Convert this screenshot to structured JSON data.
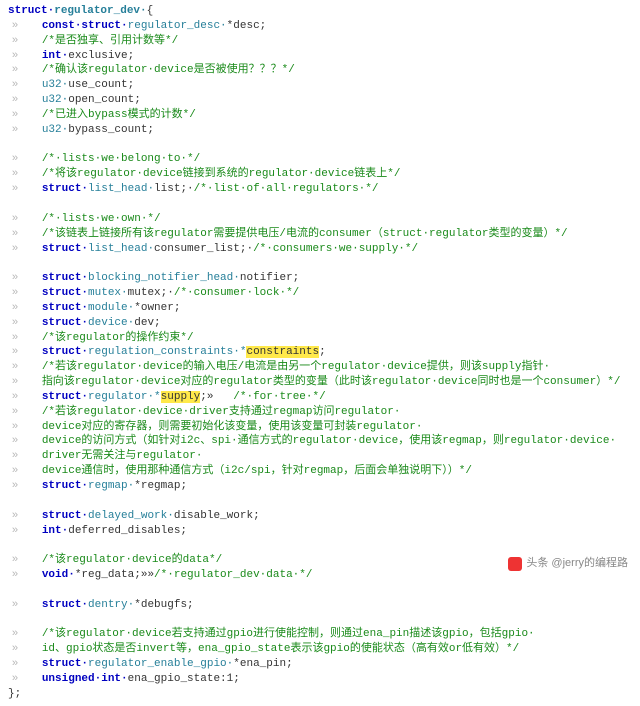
{
  "struct_name": "regulator_dev",
  "hl_constraints": "constraints",
  "hl_supply": "supply",
  "watermark": "头条 @jerry的编程路",
  "lines": {
    "l00a": "struct·",
    "l00b": "regulator_dev·",
    "l00c": "{",
    "l01a": "const·struct·",
    "l01b": "regulator_desc·",
    "l01c": "*desc;",
    "l02": "/*是否独享、引用计数等*/",
    "l03a": "int·",
    "l03b": "exclusive;",
    "l04": "/*确认该regulator·device是否被使用？？？*/",
    "l05a": "u32·",
    "l05b": "use_count;",
    "l06a": "u32·",
    "l06b": "open_count;",
    "l07": "/*已进入bypass模式的计数*/",
    "l08a": "u32·",
    "l08b": "bypass_count;",
    "l09": "/*·lists·we·belong·to·*/",
    "l10": "/*将该regulator·device链接到系统的regulator·device链表上*/",
    "l11a": "struct·",
    "l11b": "list_head·",
    "l11c": "list;·",
    "l11d": "/*·list·of·all·regulators·*/",
    "l12": "/*·lists·we·own·*/",
    "l13": "/*该链表上链接所有该regulator需要提供电压/电流的consumer（struct·regulator类型的变量）*/",
    "l14a": "struct·",
    "l14b": "list_head·",
    "l14c": "consumer_list;·",
    "l14d": "/*·consumers·we·supply·*/",
    "l15a": "struct·",
    "l15b": "blocking_notifier_head·",
    "l15c": "notifier;",
    "l16a": "struct·",
    "l16b": "mutex·",
    "l16c": "mutex;·",
    "l16d": "/*·consumer·lock·*/",
    "l17a": "struct·",
    "l17b": "module·",
    "l17c": "*owner;",
    "l18a": "struct·",
    "l18b": "device·",
    "l18c": "dev;",
    "l19": "/*该regulator的操作约束*/",
    "l20a": "struct·",
    "l20b": "regulation_constraints·*",
    "l20d": ";",
    "l21": "/*若该regulator·device的输入电压/电流是由另一个regulator·device提供，则该supply指针·",
    "l22": "指向该regulator·device对应的regulator类型的变量（此时该regulator·device同时也是一个consumer）*/",
    "l23a": "struct·",
    "l23b": "regulator·*",
    "l23d": ";»   ",
    "l23e": "/*·for·tree·*/",
    "l24": "/*若该regulator·device·driver支持通过regmap访问regulator·",
    "l25": "device对应的寄存器，则需要初始化该变量，使用该变量可封装regulator·",
    "l26": "device的访问方式（如针对i2c、spi·通信方式的regulator·device，使用该regmap，则regulator·device·",
    "l27": "driver无需关注与regulator·",
    "l28": "device通信时，使用那种通信方式（i2c/spi，针对regmap，后面会单独说明下））*/",
    "l29a": "struct·",
    "l29b": "regmap·",
    "l29c": "*regmap;",
    "l30a": "struct·",
    "l30b": "delayed_work·",
    "l30c": "disable_work;",
    "l31a": "int·",
    "l31b": "deferred_disables;",
    "l32": "/*该regulator·device的data*/",
    "l33a": "void·",
    "l33b": "*reg_data;»»",
    "l33c": "/*·regulator_dev·data·*/",
    "l34a": "struct·",
    "l34b": "dentry·",
    "l34c": "*debugfs;",
    "l35": "/*该regulator·device若支持通过gpio进行使能控制，则通过ena_pin描述该gpio，包括gpio·",
    "l36": "id、gpio状态是否invert等，ena_gpio_state表示该gpio的使能状态（高有效or低有效）*/",
    "l37a": "struct·",
    "l37b": "regulator_enable_gpio·",
    "l37c": "*ena_pin;",
    "l38a": "unsigned·int·",
    "l38b": "ena_gpio_state:1;",
    "l39": "};"
  }
}
